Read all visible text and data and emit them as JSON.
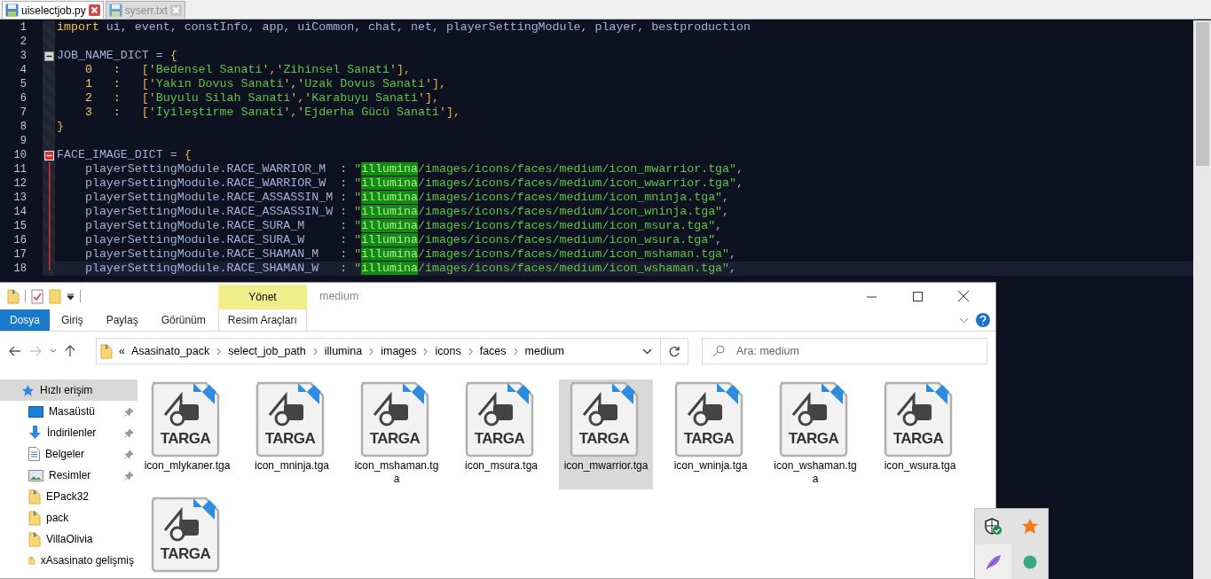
{
  "editor": {
    "tabs": [
      {
        "label": "uiselectjob.py",
        "selected": true
      },
      {
        "label": "syserr.txt",
        "selected": false
      }
    ],
    "lines": [
      {
        "number": "1",
        "fold": false,
        "active_block": false,
        "current": false,
        "segments": [
          {
            "kind": "keyword",
            "text": "import"
          },
          {
            "kind": "name",
            "text": " ui, event, constInfo, app, uiCommon, chat, net, playerSettingModule, player, bestproduction"
          }
        ]
      },
      {
        "number": "2",
        "fold": false,
        "active_block": false,
        "current": false
      },
      {
        "number": "3",
        "fold": true,
        "active_block": false,
        "current": false,
        "segments": [
          {
            "kind": "name",
            "text": "JOB_NAME_DICT = "
          },
          {
            "kind": "punct",
            "text": "{"
          }
        ]
      },
      {
        "number": "4",
        "fold": false,
        "active_block": false,
        "current": false,
        "segments": [
          {
            "kind": "number",
            "text": "    0   :   "
          },
          {
            "kind": "punct",
            "text": "['"
          },
          {
            "kind": "string",
            "text": "Bedensel Sanati"
          },
          {
            "kind": "punct",
            "text": "','"
          },
          {
            "kind": "string",
            "text": "Zihinsel Sanati"
          },
          {
            "kind": "punct",
            "text": "'],"
          }
        ]
      },
      {
        "number": "5",
        "fold": false,
        "active_block": false,
        "current": false,
        "segments": [
          {
            "kind": "number",
            "text": "    1   :   "
          },
          {
            "kind": "punct",
            "text": "['"
          },
          {
            "kind": "string",
            "text": "Yakın Dovus Sanati"
          },
          {
            "kind": "punct",
            "text": "','"
          },
          {
            "kind": "string",
            "text": "Uzak Dovus Sanati"
          },
          {
            "kind": "punct",
            "text": "'],"
          }
        ]
      },
      {
        "number": "6",
        "fold": false,
        "active_block": false,
        "current": false,
        "segments": [
          {
            "kind": "number",
            "text": "    2   :   "
          },
          {
            "kind": "punct",
            "text": "['"
          },
          {
            "kind": "string",
            "text": "Buyulu Silah Sanati"
          },
          {
            "kind": "punct",
            "text": "','"
          },
          {
            "kind": "string",
            "text": "Karabuyu Sanati"
          },
          {
            "kind": "punct",
            "text": "'],"
          }
        ]
      },
      {
        "number": "7",
        "fold": false,
        "active_block": false,
        "current": false,
        "segments": [
          {
            "kind": "number",
            "text": "    3   :   "
          },
          {
            "kind": "punct",
            "text": "['"
          },
          {
            "kind": "string",
            "text": "İyileştirme Sanati"
          },
          {
            "kind": "punct",
            "text": "','"
          },
          {
            "kind": "string",
            "text": "Ejderha Gücü Sanati"
          },
          {
            "kind": "punct",
            "text": "'],"
          }
        ]
      },
      {
        "number": "8",
        "fold": false,
        "active_block": false,
        "current": false,
        "segments": [
          {
            "kind": "punct",
            "text": "}"
          }
        ]
      },
      {
        "number": "9",
        "fold": false,
        "active_block": false,
        "current": false
      },
      {
        "number": "10",
        "fold": true,
        "active_block": true,
        "current": false,
        "segments": [
          {
            "kind": "name",
            "text": "FACE_IMAGE_DICT = "
          },
          {
            "kind": "punct",
            "text": "{"
          }
        ]
      },
      {
        "number": "11",
        "fold": false,
        "active_block": true,
        "current": false,
        "segments": [
          {
            "kind": "name",
            "text": "    playerSettingModule.RACE_WARRIOR_M  : "
          },
          {
            "kind": "string",
            "text": "\""
          },
          {
            "kind": "match",
            "text": "illumina"
          },
          {
            "kind": "string",
            "text": "/images/icons/faces/medium/icon_mwarrior.tga\""
          },
          {
            "kind": "name",
            "text": ","
          }
        ]
      },
      {
        "number": "12",
        "fold": false,
        "active_block": true,
        "current": false,
        "segments": [
          {
            "kind": "name",
            "text": "    playerSettingModule.RACE_WARRIOR_W  : "
          },
          {
            "kind": "string",
            "text": "\""
          },
          {
            "kind": "match",
            "text": "illumina"
          },
          {
            "kind": "string",
            "text": "/images/icons/faces/medium/icon_wwarrior.tga\""
          },
          {
            "kind": "name",
            "text": ","
          }
        ]
      },
      {
        "number": "13",
        "fold": false,
        "active_block": true,
        "current": false,
        "segments": [
          {
            "kind": "name",
            "text": "    playerSettingModule.RACE_ASSASSIN_M : "
          },
          {
            "kind": "string",
            "text": "\""
          },
          {
            "kind": "match",
            "text": "illumina"
          },
          {
            "kind": "string",
            "text": "/images/icons/faces/medium/icon_mninja.tga\""
          },
          {
            "kind": "name",
            "text": ","
          }
        ]
      },
      {
        "number": "14",
        "fold": false,
        "active_block": true,
        "current": false,
        "segments": [
          {
            "kind": "name",
            "text": "    playerSettingModule.RACE_ASSASSIN_W : "
          },
          {
            "kind": "string",
            "text": "\""
          },
          {
            "kind": "match",
            "text": "illumina"
          },
          {
            "kind": "string",
            "text": "/images/icons/faces/medium/icon_wninja.tga\""
          },
          {
            "kind": "name",
            "text": ","
          }
        ]
      },
      {
        "number": "15",
        "fold": false,
        "active_block": true,
        "current": false,
        "segments": [
          {
            "kind": "name",
            "text": "    playerSettingModule.RACE_SURA_M     : "
          },
          {
            "kind": "string",
            "text": "\""
          },
          {
            "kind": "match",
            "text": "illumina"
          },
          {
            "kind": "string",
            "text": "/images/icons/faces/medium/icon_msura.tga\""
          },
          {
            "kind": "name",
            "text": ","
          }
        ]
      },
      {
        "number": "16",
        "fold": false,
        "active_block": true,
        "current": false,
        "segments": [
          {
            "kind": "name",
            "text": "    playerSettingModule.RACE_SURA_W     : "
          },
          {
            "kind": "string",
            "text": "\""
          },
          {
            "kind": "match",
            "text": "illumina"
          },
          {
            "kind": "string",
            "text": "/images/icons/faces/medium/icon_wsura.tga\""
          },
          {
            "kind": "name",
            "text": ","
          }
        ]
      },
      {
        "number": "17",
        "fold": false,
        "active_block": true,
        "current": false,
        "segments": [
          {
            "kind": "name",
            "text": "    playerSettingModule.RACE_SHAMAN_M   : "
          },
          {
            "kind": "string",
            "text": "\""
          },
          {
            "kind": "match",
            "text": "illumina"
          },
          {
            "kind": "string",
            "text": "/images/icons/faces/medium/icon_mshaman.tga\""
          },
          {
            "kind": "name",
            "text": ","
          }
        ]
      },
      {
        "number": "18",
        "fold": false,
        "active_block": true,
        "current": true,
        "segments": [
          {
            "kind": "name",
            "text": "    playerSettingModule.RACE_SHAMAN_W   : "
          },
          {
            "kind": "string",
            "text": "\""
          },
          {
            "kind": "match",
            "text": "illumina"
          },
          {
            "kind": "string",
            "text": "/images/icons/faces/medium/icon_wshaman.tga\""
          },
          {
            "kind": "name",
            "text": ","
          }
        ]
      }
    ]
  },
  "explorer": {
    "title": "medium",
    "context_group": "Yönet",
    "ribbon_tabs": [
      {
        "label": "Dosya",
        "kind": "file",
        "selected": false
      },
      {
        "label": "Giriş",
        "kind": "tab",
        "selected": false
      },
      {
        "label": "Paylaş",
        "kind": "tab",
        "selected": false
      },
      {
        "label": "Görünüm",
        "kind": "tab",
        "selected": false
      },
      {
        "label": "Resim Araçları",
        "kind": "context",
        "selected": false
      }
    ],
    "address": {
      "overflow": "«",
      "crumbs": [
        "Asasinato_pack",
        "select_job_path",
        "illumina",
        "images",
        "icons",
        "faces",
        "medium"
      ]
    },
    "search": {
      "placeholder": "Ara: medium"
    },
    "sidebar": [
      {
        "label": "Hızlı erişim",
        "kind": "quick",
        "pinned": false,
        "selected": true
      },
      {
        "label": "Masaüstü",
        "kind": "desktop",
        "pinned": true,
        "selected": false
      },
      {
        "label": "İndirilenler",
        "kind": "download",
        "pinned": true,
        "selected": false
      },
      {
        "label": "Belgeler",
        "kind": "documents",
        "pinned": true,
        "selected": false
      },
      {
        "label": "Resimler",
        "kind": "pictures",
        "pinned": true,
        "selected": false
      },
      {
        "label": "EPack32",
        "kind": "folder",
        "pinned": false,
        "selected": false
      },
      {
        "label": "pack",
        "kind": "folder",
        "pinned": false,
        "selected": false
      },
      {
        "label": "VillaOlivia",
        "kind": "folder",
        "pinned": false,
        "selected": false
      },
      {
        "label": "xAsasinato gelişmiş",
        "kind": "folder",
        "pinned": false,
        "selected": false
      }
    ],
    "files": [
      {
        "name": "icon_mlykaner.tga",
        "type_label": "TARGA",
        "selected": false
      },
      {
        "name": "icon_mninja.tga",
        "type_label": "TARGA",
        "selected": false
      },
      {
        "name": "icon_mshaman.tga",
        "type_label": "TARGA",
        "selected": false
      },
      {
        "name": "icon_msura.tga",
        "type_label": "TARGA",
        "selected": false
      },
      {
        "name": "icon_mwarrior.tga",
        "type_label": "TARGA",
        "selected": true
      },
      {
        "name": "icon_wninja.tga",
        "type_label": "TARGA",
        "selected": false
      },
      {
        "name": "icon_wshaman.tga",
        "type_label": "TARGA",
        "selected": false
      },
      {
        "name": "icon_wsura.tga",
        "type_label": "TARGA",
        "selected": false
      },
      {
        "type_label": "TARGA",
        "selected": false
      }
    ]
  }
}
